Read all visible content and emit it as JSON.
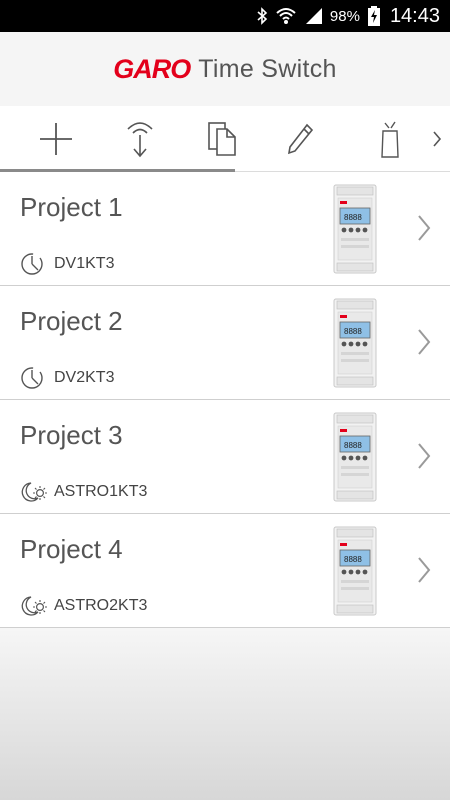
{
  "status_bar": {
    "battery_percent": "98%",
    "time": "14:43",
    "icons": [
      "bluetooth-icon",
      "wifi-icon",
      "signal-icon",
      "battery-charging-icon"
    ]
  },
  "header": {
    "brand": "GARO",
    "title": "Time Switch"
  },
  "toolbar": {
    "items": [
      "add-icon",
      "download-icon",
      "copy-icon",
      "edit-icon",
      "delete-icon",
      "chevron-right-icon"
    ],
    "active_index": 0
  },
  "projects": [
    {
      "title": "Project 1",
      "model": "DV1KT3",
      "type_icon": "clock-icon"
    },
    {
      "title": "Project 2",
      "model": "DV2KT3",
      "type_icon": "clock-icon"
    },
    {
      "title": "Project 3",
      "model": "ASTRO1KT3",
      "type_icon": "astro-icon"
    },
    {
      "title": "Project 4",
      "model": "ASTRO2KT3",
      "type_icon": "astro-icon"
    }
  ],
  "colors": {
    "brand_red": "#e3001b",
    "text": "#555555",
    "divider": "#cfcfcf",
    "lcd": "#8fc0e6"
  }
}
